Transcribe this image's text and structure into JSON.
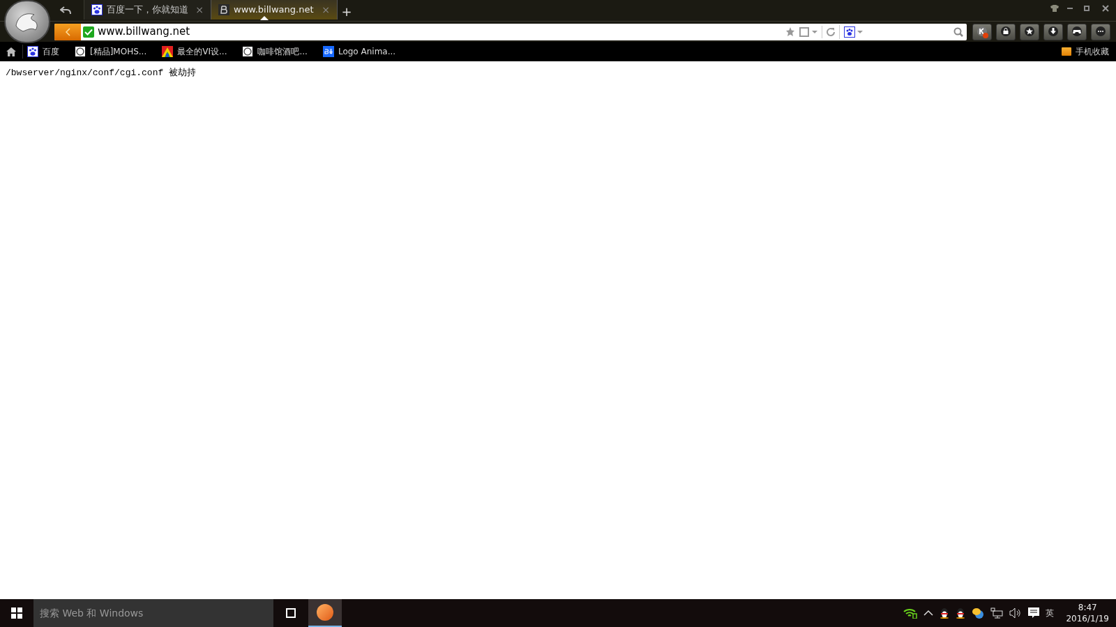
{
  "tabs": [
    {
      "label": "百度一下，你就知道",
      "kind": "paw",
      "selected": false,
      "close": "×"
    },
    {
      "label": "www.billwang.net",
      "kind": "letter-b",
      "selected": true,
      "close": "×"
    }
  ],
  "new_tab": "+",
  "address_bar": {
    "url": "www.billwang.net",
    "secure": true
  },
  "bookmarks": [
    {
      "label": "百度",
      "kind": "paw"
    },
    {
      "label": "[精品]MOHS...",
      "kind": "page"
    },
    {
      "label": "最全的VI设...",
      "kind": "colorful"
    },
    {
      "label": "咖啡馆酒吧...",
      "kind": "page"
    },
    {
      "label": "Logo Anima...",
      "kind": "be"
    }
  ],
  "mobile_bookmarks": "手机收藏",
  "content": {
    "text": "/bwserver/nginx/conf/cgi.conf 被劫持"
  },
  "taskbar": {
    "search": {
      "placeholder": "搜索 Web 和 Windows"
    },
    "input_method": "英",
    "time": "8:47",
    "date": "2016/1/19"
  }
}
